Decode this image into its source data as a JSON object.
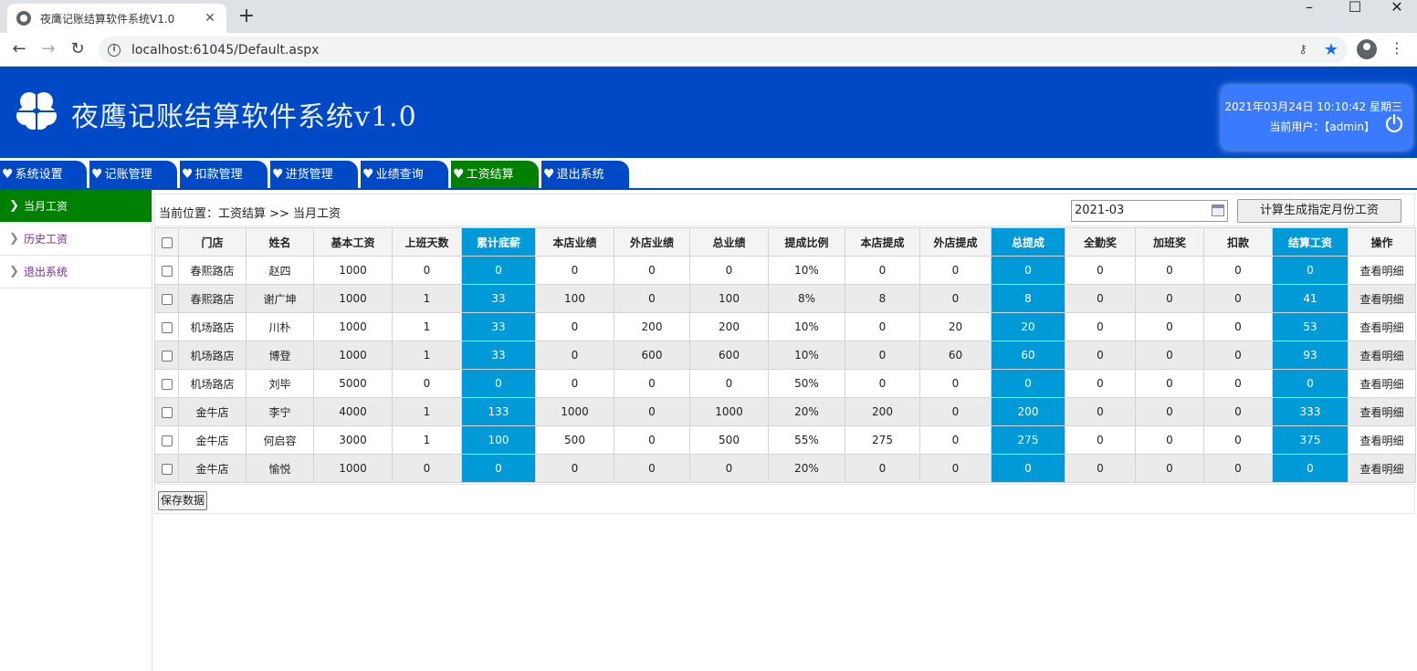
{
  "browser": {
    "tab_title": "夜鹰记账结算软件系统V1.0",
    "url": "localhost:61045/Default.aspx"
  },
  "header": {
    "title": "夜鹰记账结算软件系统v1.0",
    "datetime": "2021年03月24日 10:10:42 星期三",
    "current_user": "当前用户：【admin】"
  },
  "menu": [
    {
      "label": "系统设置"
    },
    {
      "label": "记账管理"
    },
    {
      "label": "扣款管理"
    },
    {
      "label": "进货管理"
    },
    {
      "label": "业绩查询"
    },
    {
      "label": "工资结算",
      "active": true
    },
    {
      "label": "退出系统"
    }
  ],
  "sidebar": [
    {
      "label": "当月工资",
      "active": true
    },
    {
      "label": "历史工资"
    },
    {
      "label": "退出系统"
    }
  ],
  "breadcrumb": "当前位置：工资结算 >> 当月工资",
  "month_value": "2021-03",
  "calc_button": "计算生成指定月份工资",
  "save_button": "保存数据",
  "colors": {
    "header_bg": "#0049c6",
    "active_green": "#008000",
    "highlight_col": "#009ad9"
  },
  "table": {
    "columns": [
      "门店",
      "姓名",
      "基本工资",
      "上班天数",
      "累计底薪",
      "本店业绩",
      "外店业绩",
      "总业绩",
      "提成比例",
      "本店提成",
      "外店提成",
      "总提成",
      "全勤奖",
      "加班奖",
      "扣款",
      "结算工资",
      "操作"
    ],
    "rows": [
      [
        "春熙路店",
        "赵四",
        "1000",
        "0",
        "0",
        "0",
        "0",
        "0",
        "10%",
        "0",
        "0",
        "0",
        "0",
        "0",
        "0",
        "0",
        "查看明细"
      ],
      [
        "春熙路店",
        "谢广坤",
        "1000",
        "1",
        "33",
        "100",
        "0",
        "100",
        "8%",
        "8",
        "0",
        "8",
        "0",
        "0",
        "0",
        "41",
        "查看明细"
      ],
      [
        "机场路店",
        "川朴",
        "1000",
        "1",
        "33",
        "0",
        "200",
        "200",
        "10%",
        "0",
        "20",
        "20",
        "0",
        "0",
        "0",
        "53",
        "查看明细"
      ],
      [
        "机场路店",
        "博登",
        "1000",
        "1",
        "33",
        "0",
        "600",
        "600",
        "10%",
        "0",
        "60",
        "60",
        "0",
        "0",
        "0",
        "93",
        "查看明细"
      ],
      [
        "机场路店",
        "刘毕",
        "5000",
        "0",
        "0",
        "0",
        "0",
        "0",
        "50%",
        "0",
        "0",
        "0",
        "0",
        "0",
        "0",
        "0",
        "查看明细"
      ],
      [
        "金牛店",
        "李宁",
        "4000",
        "1",
        "133",
        "1000",
        "0",
        "1000",
        "20%",
        "200",
        "0",
        "200",
        "0",
        "0",
        "0",
        "333",
        "查看明细"
      ],
      [
        "金牛店",
        "何启容",
        "3000",
        "1",
        "100",
        "500",
        "0",
        "500",
        "55%",
        "275",
        "0",
        "275",
        "0",
        "0",
        "0",
        "375",
        "查看明细"
      ],
      [
        "金牛店",
        "愉悦",
        "1000",
        "0",
        "0",
        "0",
        "0",
        "0",
        "20%",
        "0",
        "0",
        "0",
        "0",
        "0",
        "0",
        "0",
        "查看明细"
      ]
    ]
  }
}
